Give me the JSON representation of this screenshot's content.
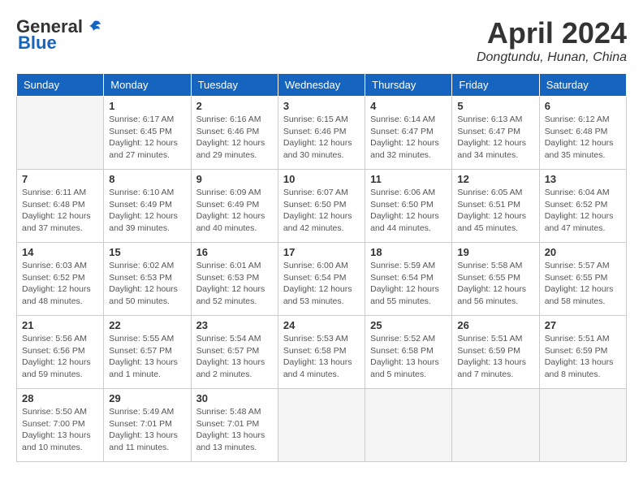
{
  "header": {
    "logo_general": "General",
    "logo_blue": "Blue",
    "title": "April 2024",
    "location": "Dongtundu, Hunan, China"
  },
  "days_of_week": [
    "Sunday",
    "Monday",
    "Tuesday",
    "Wednesday",
    "Thursday",
    "Friday",
    "Saturday"
  ],
  "weeks": [
    [
      {
        "day": "",
        "info": ""
      },
      {
        "day": "1",
        "info": "Sunrise: 6:17 AM\nSunset: 6:45 PM\nDaylight: 12 hours\nand 27 minutes."
      },
      {
        "day": "2",
        "info": "Sunrise: 6:16 AM\nSunset: 6:46 PM\nDaylight: 12 hours\nand 29 minutes."
      },
      {
        "day": "3",
        "info": "Sunrise: 6:15 AM\nSunset: 6:46 PM\nDaylight: 12 hours\nand 30 minutes."
      },
      {
        "day": "4",
        "info": "Sunrise: 6:14 AM\nSunset: 6:47 PM\nDaylight: 12 hours\nand 32 minutes."
      },
      {
        "day": "5",
        "info": "Sunrise: 6:13 AM\nSunset: 6:47 PM\nDaylight: 12 hours\nand 34 minutes."
      },
      {
        "day": "6",
        "info": "Sunrise: 6:12 AM\nSunset: 6:48 PM\nDaylight: 12 hours\nand 35 minutes."
      }
    ],
    [
      {
        "day": "7",
        "info": "Sunrise: 6:11 AM\nSunset: 6:48 PM\nDaylight: 12 hours\nand 37 minutes."
      },
      {
        "day": "8",
        "info": "Sunrise: 6:10 AM\nSunset: 6:49 PM\nDaylight: 12 hours\nand 39 minutes."
      },
      {
        "day": "9",
        "info": "Sunrise: 6:09 AM\nSunset: 6:49 PM\nDaylight: 12 hours\nand 40 minutes."
      },
      {
        "day": "10",
        "info": "Sunrise: 6:07 AM\nSunset: 6:50 PM\nDaylight: 12 hours\nand 42 minutes."
      },
      {
        "day": "11",
        "info": "Sunrise: 6:06 AM\nSunset: 6:50 PM\nDaylight: 12 hours\nand 44 minutes."
      },
      {
        "day": "12",
        "info": "Sunrise: 6:05 AM\nSunset: 6:51 PM\nDaylight: 12 hours\nand 45 minutes."
      },
      {
        "day": "13",
        "info": "Sunrise: 6:04 AM\nSunset: 6:52 PM\nDaylight: 12 hours\nand 47 minutes."
      }
    ],
    [
      {
        "day": "14",
        "info": "Sunrise: 6:03 AM\nSunset: 6:52 PM\nDaylight: 12 hours\nand 48 minutes."
      },
      {
        "day": "15",
        "info": "Sunrise: 6:02 AM\nSunset: 6:53 PM\nDaylight: 12 hours\nand 50 minutes."
      },
      {
        "day": "16",
        "info": "Sunrise: 6:01 AM\nSunset: 6:53 PM\nDaylight: 12 hours\nand 52 minutes."
      },
      {
        "day": "17",
        "info": "Sunrise: 6:00 AM\nSunset: 6:54 PM\nDaylight: 12 hours\nand 53 minutes."
      },
      {
        "day": "18",
        "info": "Sunrise: 5:59 AM\nSunset: 6:54 PM\nDaylight: 12 hours\nand 55 minutes."
      },
      {
        "day": "19",
        "info": "Sunrise: 5:58 AM\nSunset: 6:55 PM\nDaylight: 12 hours\nand 56 minutes."
      },
      {
        "day": "20",
        "info": "Sunrise: 5:57 AM\nSunset: 6:55 PM\nDaylight: 12 hours\nand 58 minutes."
      }
    ],
    [
      {
        "day": "21",
        "info": "Sunrise: 5:56 AM\nSunset: 6:56 PM\nDaylight: 12 hours\nand 59 minutes."
      },
      {
        "day": "22",
        "info": "Sunrise: 5:55 AM\nSunset: 6:57 PM\nDaylight: 13 hours\nand 1 minute."
      },
      {
        "day": "23",
        "info": "Sunrise: 5:54 AM\nSunset: 6:57 PM\nDaylight: 13 hours\nand 2 minutes."
      },
      {
        "day": "24",
        "info": "Sunrise: 5:53 AM\nSunset: 6:58 PM\nDaylight: 13 hours\nand 4 minutes."
      },
      {
        "day": "25",
        "info": "Sunrise: 5:52 AM\nSunset: 6:58 PM\nDaylight: 13 hours\nand 5 minutes."
      },
      {
        "day": "26",
        "info": "Sunrise: 5:51 AM\nSunset: 6:59 PM\nDaylight: 13 hours\nand 7 minutes."
      },
      {
        "day": "27",
        "info": "Sunrise: 5:51 AM\nSunset: 6:59 PM\nDaylight: 13 hours\nand 8 minutes."
      }
    ],
    [
      {
        "day": "28",
        "info": "Sunrise: 5:50 AM\nSunset: 7:00 PM\nDaylight: 13 hours\nand 10 minutes."
      },
      {
        "day": "29",
        "info": "Sunrise: 5:49 AM\nSunset: 7:01 PM\nDaylight: 13 hours\nand 11 minutes."
      },
      {
        "day": "30",
        "info": "Sunrise: 5:48 AM\nSunset: 7:01 PM\nDaylight: 13 hours\nand 13 minutes."
      },
      {
        "day": "",
        "info": ""
      },
      {
        "day": "",
        "info": ""
      },
      {
        "day": "",
        "info": ""
      },
      {
        "day": "",
        "info": ""
      }
    ]
  ]
}
